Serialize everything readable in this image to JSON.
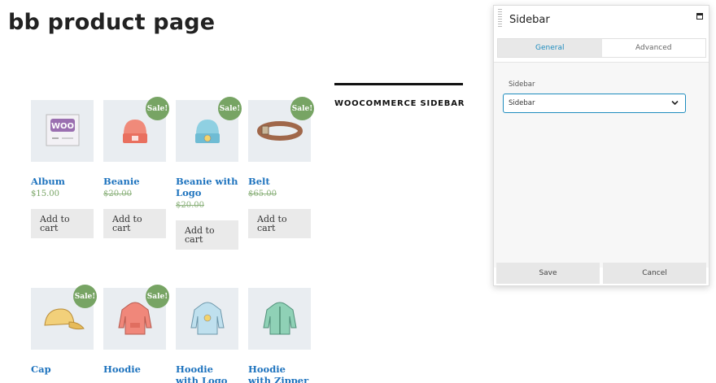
{
  "page": {
    "title": "bb product page"
  },
  "products": [
    {
      "name": "Album",
      "price": "$15.00",
      "sale": "",
      "old_price": "",
      "button": "Add to cart",
      "icon": "woo-album-icon"
    },
    {
      "name": "Beanie",
      "price": "",
      "sale": "Sale!",
      "old_price": "$20.00",
      "button": "Add to cart",
      "icon": "beanie-icon"
    },
    {
      "name": "Beanie with Logo",
      "price": "",
      "sale": "Sale!",
      "old_price": "$20.00",
      "button": "Add to cart",
      "icon": "beanie-logo-icon"
    },
    {
      "name": "Belt",
      "price": "",
      "sale": "Sale!",
      "old_price": "$65.00",
      "button": "Add to cart",
      "icon": "belt-icon"
    },
    {
      "name": "Cap",
      "price": "",
      "sale": "Sale!",
      "old_price": "",
      "button": "",
      "icon": "cap-icon"
    },
    {
      "name": "Hoodie",
      "price": "",
      "sale": "Sale!",
      "old_price": "",
      "button": "",
      "icon": "hoodie-icon"
    },
    {
      "name": "Hoodie with Logo",
      "price": "",
      "sale": "",
      "old_price": "",
      "button": "",
      "icon": "hoodie-logo-icon"
    },
    {
      "name": "Hoodie with Zipper",
      "price": "",
      "sale": "",
      "old_price": "",
      "button": "",
      "icon": "hoodie-zipper-icon"
    }
  ],
  "sidebar_widget": {
    "title": "WOOCOMMERCE SIDEBAR"
  },
  "panel": {
    "title": "Sidebar",
    "tabs": [
      {
        "label": "General",
        "active": true
      },
      {
        "label": "Advanced",
        "active": false
      }
    ],
    "field_label": "Sidebar",
    "select_value": "Sidebar",
    "save_label": "Save",
    "cancel_label": "Cancel"
  },
  "colors": {
    "link": "#1e73be",
    "sale": "#77a464",
    "accent": "#1e8cbe"
  }
}
